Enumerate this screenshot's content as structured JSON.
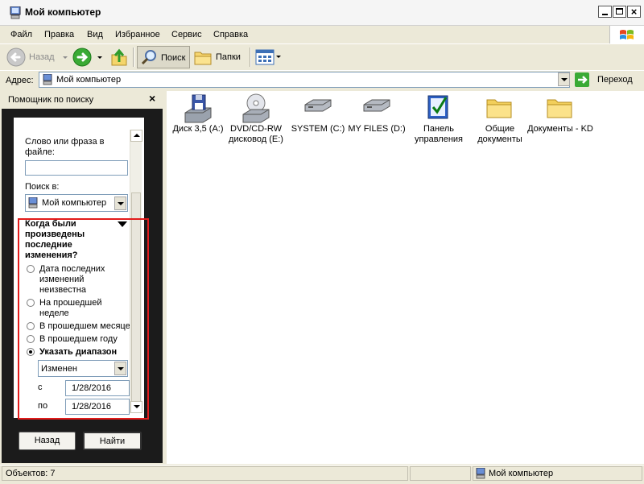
{
  "window": {
    "title": "Мой компьютер"
  },
  "menu": {
    "items": [
      "Файл",
      "Правка",
      "Вид",
      "Избранное",
      "Сервис",
      "Справка"
    ]
  },
  "toolbar": {
    "back_label": "Назад",
    "search_label": "Поиск",
    "folders_label": "Папки"
  },
  "address": {
    "label": "Адрес:",
    "value": "Мой компьютер",
    "go_label": "Переход"
  },
  "search_pane": {
    "title": "Помощник по поиску",
    "word_label": "Слово или фраза в файле:",
    "word_value": "",
    "look_in_label": "Поиск в:",
    "look_in_value": "Мой компьютер",
    "modified_heading": "Когда были произведены последние изменения?",
    "options": [
      {
        "label": "Дата последних изменений неизвестна",
        "checked": false
      },
      {
        "label": "На прошедшей неделе",
        "checked": false
      },
      {
        "label": "В прошедшем месяце",
        "checked": false
      },
      {
        "label": "В прошедшем году",
        "checked": false
      },
      {
        "label": "Указать диапазон",
        "checked": true
      }
    ],
    "range_type": "Изменен",
    "from_label": "с",
    "from_date": "1/28/2016",
    "to_label": "по",
    "to_date": "1/28/2016",
    "back_button": "Назад",
    "find_button": "Найти"
  },
  "files": [
    {
      "label": "Диск 3,5 (A:)",
      "icon": "floppy-drive-icon"
    },
    {
      "label": "DVD/CD-RW дисковод (E:)",
      "icon": "dvd-drive-icon"
    },
    {
      "label": "SYSTEM (C:)",
      "icon": "hard-drive-icon"
    },
    {
      "label": "MY FILES (D:)",
      "icon": "hard-drive-icon"
    },
    {
      "label": "Панель управления",
      "icon": "control-panel-icon"
    },
    {
      "label": "Общие документы",
      "icon": "folder-icon"
    },
    {
      "label": "Документы - KD",
      "icon": "folder-icon"
    }
  ],
  "status": {
    "objects": "Объектов: 7",
    "location": "Мой компьютер"
  }
}
